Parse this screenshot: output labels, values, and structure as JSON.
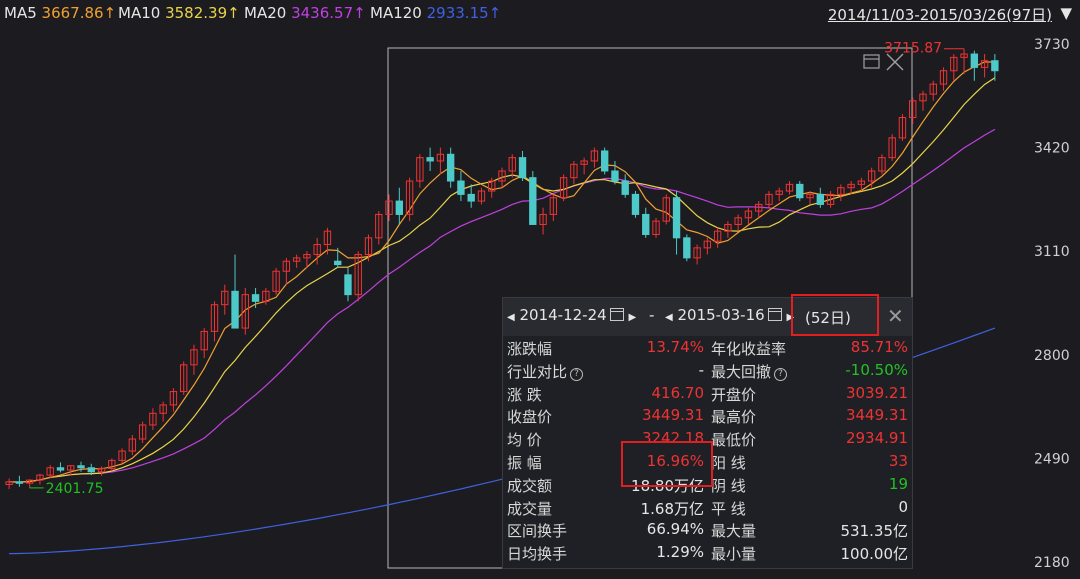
{
  "header": {
    "ma5_label": "MA5",
    "ma5_value": "3667.86↑",
    "ma10_label": "MA10",
    "ma10_value": "3582.39↑",
    "ma20_label": "MA20",
    "ma20_value": "3436.57↑",
    "ma120_label": "MA120",
    "ma120_value": "2933.15↑",
    "range_label": "2014/11/03-2015/03/26(97日)",
    "range_dropdown_icon": "triangle-down-icon"
  },
  "colors": {
    "background": "#1c1c20",
    "up": "#ee3333",
    "down": "#4ec9c9",
    "ma5": "#f0a030",
    "ma10": "#e8d44a",
    "ma20": "#c040e0",
    "ma120": "#4060e0",
    "highlight_box": "#e02020"
  },
  "chart": {
    "y_ticks": [
      "3730",
      "3420",
      "3110",
      "2800",
      "2490",
      "2180"
    ],
    "low_marker": "2401.75",
    "high_marker": "3715.87",
    "selection_icons": [
      "window-icon",
      "close-icon"
    ]
  },
  "stats": {
    "start_date": "2014-12-24",
    "separator": "-",
    "end_date": "2015-03-16",
    "days": "(52日)",
    "rows": [
      {
        "k1": "涨跌幅",
        "v1": "13.74%",
        "c1": "red",
        "k2": "年化收益率",
        "v2": "85.71%",
        "c2": "red"
      },
      {
        "k1": "行业对比",
        "q1": true,
        "v1": "-",
        "c1": "white",
        "k2": "最大回撤",
        "q2": true,
        "v2": "-10.50%",
        "c2": "green"
      },
      {
        "k1": "涨  跌",
        "v1": "416.70",
        "c1": "red",
        "k2": "开盘价",
        "v2": "3039.21",
        "c2": "red"
      },
      {
        "k1": "收盘价",
        "v1": "3449.31",
        "c1": "red",
        "k2": "最高价",
        "v2": "3449.31",
        "c2": "red"
      },
      {
        "k1": "均  价",
        "v1": "3242.18",
        "c1": "red",
        "k2": "最低价",
        "v2": "2934.91",
        "c2": "red"
      },
      {
        "k1": "振  幅",
        "v1": "16.96%",
        "c1": "red",
        "k2": "阳  线",
        "v2": "33",
        "c2": "red"
      },
      {
        "k1": "成交额",
        "v1": "18.80万亿",
        "c1": "white",
        "k2": "阴  线",
        "v2": "19",
        "c2": "green"
      },
      {
        "k1": "成交量",
        "v1": "1.68万亿",
        "c1": "white",
        "k2": "平  线",
        "v2": "0",
        "c2": "white"
      },
      {
        "k1": "区间换手",
        "v1": "66.94%",
        "c1": "white",
        "k2": "最大量",
        "v2": "531.35亿",
        "c2": "white"
      },
      {
        "k1": "日均换手",
        "v1": "1.29%",
        "c1": "white",
        "k2": "最小量",
        "v2": "100.00亿",
        "c2": "white"
      }
    ]
  },
  "chart_data": {
    "type": "candlestick",
    "y_range": [
      2180,
      3730
    ],
    "candles": [
      [
        2412,
        2430,
        2398,
        2420
      ],
      [
        2420,
        2438,
        2405,
        2418
      ],
      [
        2416,
        2428,
        2401.75,
        2425
      ],
      [
        2425,
        2444,
        2412,
        2440
      ],
      [
        2440,
        2470,
        2432,
        2462
      ],
      [
        2462,
        2478,
        2448,
        2455
      ],
      [
        2455,
        2470,
        2440,
        2468
      ],
      [
        2468,
        2480,
        2450,
        2462
      ],
      [
        2462,
        2474,
        2440,
        2450
      ],
      [
        2450,
        2466,
        2438,
        2460
      ],
      [
        2460,
        2490,
        2452,
        2484
      ],
      [
        2484,
        2520,
        2476,
        2512
      ],
      [
        2512,
        2560,
        2500,
        2548
      ],
      [
        2548,
        2600,
        2536,
        2590
      ],
      [
        2590,
        2640,
        2575,
        2625
      ],
      [
        2625,
        2660,
        2600,
        2650
      ],
      [
        2650,
        2700,
        2630,
        2690
      ],
      [
        2690,
        2780,
        2680,
        2770
      ],
      [
        2770,
        2830,
        2740,
        2815
      ],
      [
        2815,
        2880,
        2790,
        2870
      ],
      [
        2870,
        2960,
        2840,
        2950
      ],
      [
        2950,
        3010,
        2920,
        2990
      ],
      [
        2990,
        3100,
        2940,
        2880
      ],
      [
        2880,
        3000,
        2860,
        2980
      ],
      [
        2980,
        3000,
        2940,
        2960
      ],
      [
        2960,
        3000,
        2950,
        2990
      ],
      [
        2990,
        3060,
        2980,
        3050
      ],
      [
        3050,
        3090,
        3010,
        3080
      ],
      [
        3080,
        3100,
        3060,
        3090
      ],
      [
        3090,
        3110,
        3060,
        3100
      ],
      [
        3100,
        3150,
        3070,
        3130
      ],
      [
        3130,
        3180,
        3100,
        3170
      ],
      [
        3080,
        3120,
        3060,
        3070
      ],
      [
        3039.21,
        3060,
        2960,
        2980
      ],
      [
        2980,
        3110,
        2960,
        3100
      ],
      [
        3100,
        3160,
        3080,
        3150
      ],
      [
        3150,
        3230,
        3130,
        3220
      ],
      [
        3220,
        3280,
        3200,
        3260
      ],
      [
        3260,
        3300,
        3190,
        3220
      ],
      [
        3220,
        3330,
        3200,
        3320
      ],
      [
        3320,
        3400,
        3300,
        3390
      ],
      [
        3390,
        3420,
        3350,
        3380
      ],
      [
        3380,
        3420,
        3340,
        3400
      ],
      [
        3400,
        3420,
        3300,
        3320
      ],
      [
        3320,
        3350,
        3260,
        3280
      ],
      [
        3280,
        3310,
        3240,
        3260
      ],
      [
        3260,
        3300,
        3250,
        3290
      ],
      [
        3290,
        3330,
        3270,
        3320
      ],
      [
        3320,
        3360,
        3300,
        3350
      ],
      [
        3350,
        3400,
        3330,
        3390
      ],
      [
        3390,
        3410,
        3320,
        3330
      ],
      [
        3330,
        3350,
        3200,
        3190
      ],
      [
        3190,
        3240,
        3160,
        3220
      ],
      [
        3220,
        3280,
        3200,
        3270
      ],
      [
        3270,
        3340,
        3260,
        3330
      ],
      [
        3330,
        3380,
        3310,
        3370
      ],
      [
        3370,
        3390,
        3340,
        3380
      ],
      [
        3380,
        3420,
        3360,
        3410
      ],
      [
        3410,
        3420,
        3340,
        3350
      ],
      [
        3350,
        3380,
        3310,
        3320
      ],
      [
        3320,
        3340,
        3270,
        3280
      ],
      [
        3280,
        3290,
        3210,
        3220
      ],
      [
        3220,
        3240,
        3150,
        3160
      ],
      [
        3160,
        3210,
        3150,
        3200
      ],
      [
        3200,
        3280,
        3190,
        3270
      ],
      [
        3270,
        3290,
        3100,
        3150
      ],
      [
        3150,
        3160,
        3080,
        3090
      ],
      [
        3090,
        3130,
        3070,
        3120
      ],
      [
        3120,
        3150,
        3100,
        3140
      ],
      [
        3140,
        3180,
        3120,
        3170
      ],
      [
        3170,
        3200,
        3150,
        3190
      ],
      [
        3190,
        3220,
        3170,
        3210
      ],
      [
        3210,
        3240,
        3190,
        3230
      ],
      [
        3230,
        3260,
        3210,
        3250
      ],
      [
        3250,
        3290,
        3240,
        3280
      ],
      [
        3280,
        3300,
        3260,
        3290
      ],
      [
        3290,
        3320,
        3280,
        3310
      ],
      [
        3310,
        3320,
        3260,
        3270
      ],
      [
        3270,
        3290,
        3250,
        3280
      ],
      [
        3280,
        3300,
        3240,
        3250
      ],
      [
        3250,
        3290,
        3240,
        3280
      ],
      [
        3280,
        3310,
        3260,
        3300
      ],
      [
        3300,
        3320,
        3280,
        3310
      ],
      [
        3310,
        3330,
        3290,
        3320
      ],
      [
        3320,
        3360,
        3300,
        3350
      ],
      [
        3350,
        3400,
        3340,
        3390
      ],
      [
        3390,
        3460,
        3380,
        3449.31
      ],
      [
        3449,
        3520,
        3440,
        3510
      ],
      [
        3510,
        3570,
        3490,
        3560
      ],
      [
        3560,
        3590,
        3530,
        3580
      ],
      [
        3580,
        3620,
        3560,
        3610
      ],
      [
        3610,
        3660,
        3590,
        3650
      ],
      [
        3650,
        3700,
        3620,
        3690
      ],
      [
        3690,
        3715.87,
        3640,
        3700
      ],
      [
        3700,
        3710,
        3620,
        3660
      ],
      [
        3660,
        3700,
        3630,
        3680
      ],
      [
        3680,
        3700,
        3620,
        3650
      ]
    ],
    "highlight_days": 52
  }
}
